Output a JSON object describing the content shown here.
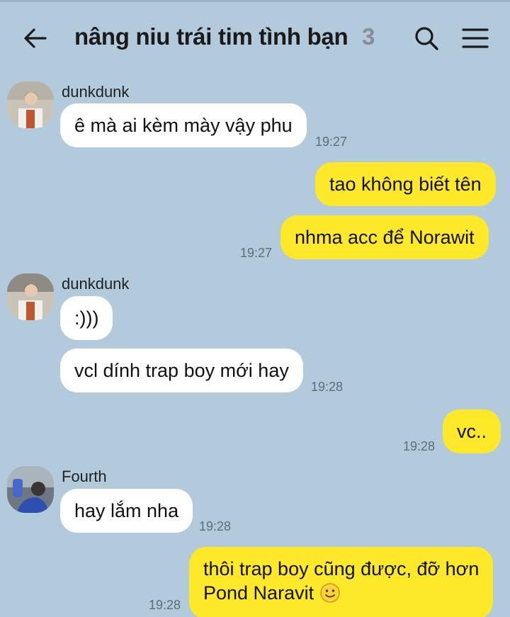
{
  "header": {
    "title": "nâng niu trái tim tình bạn",
    "member_count": "3"
  },
  "colors": {
    "background": "#b3c9dc",
    "incoming_bubble": "#ffffff",
    "outgoing_bubble": "#fde829",
    "time_text": "#5f6d7a"
  },
  "icons": [
    "back-arrow-icon",
    "search-icon",
    "menu-icon",
    "smile-emoji-icon"
  ],
  "messages": [
    {
      "sender": "dunkdunk",
      "text": "ê mà ai kèm mày vậy phu",
      "time": "19:27"
    },
    {
      "text": "tao không biết tên"
    },
    {
      "text": "nhma acc để Norawit",
      "time": "19:27"
    },
    {
      "sender": "dunkdunk",
      "text": ":)))"
    },
    {
      "text": "vcl dính trap boy mới hay",
      "time": "19:28"
    },
    {
      "text": "vc..",
      "time": "19:28"
    },
    {
      "sender": "Fourth",
      "text": "hay lắm nha",
      "time": "19:28"
    },
    {
      "line1": "thôi trap boy cũng được, đỡ hơn",
      "line2": "Pond Naravit",
      "time": "19:28"
    }
  ]
}
